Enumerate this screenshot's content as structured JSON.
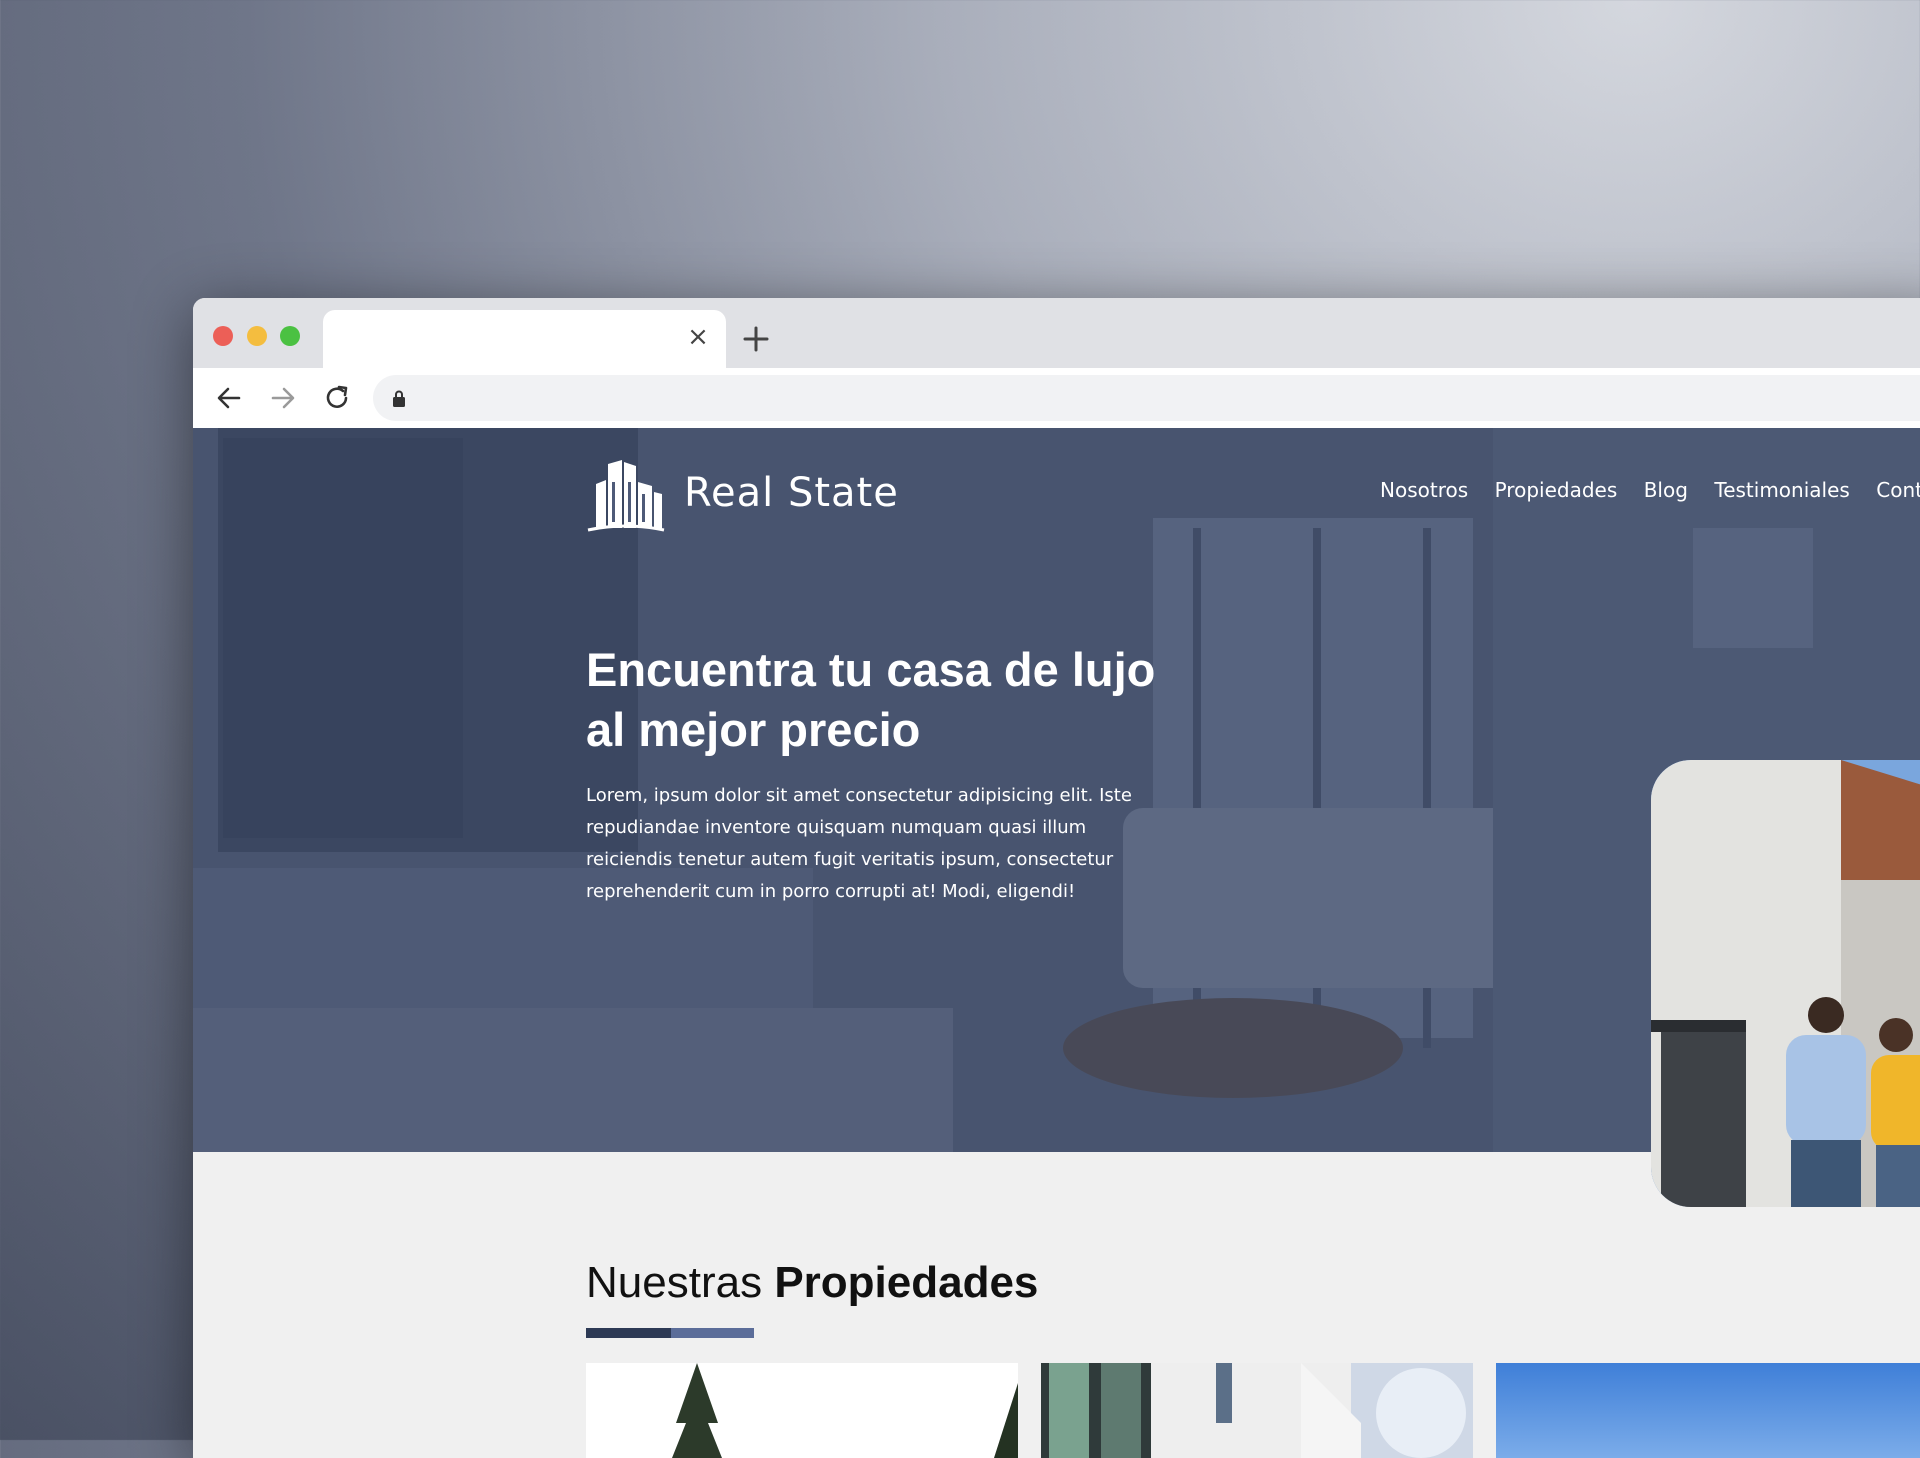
{
  "browser": {
    "tab_close_symbol": "×",
    "icons": {
      "close": "close-icon",
      "new_tab": "plus-icon",
      "back": "arrow-left-icon",
      "forward": "arrow-right-icon",
      "reload": "reload-icon",
      "secure": "lock-icon"
    },
    "traffic_light_colors": [
      "#ec5f57",
      "#f4bd3f",
      "#4bc142"
    ]
  },
  "site": {
    "brand": "Real State",
    "nav": [
      "Nosotros",
      "Propiedades",
      "Blog",
      "Testimoniales",
      "Contacto"
    ],
    "hero": {
      "title": "Encuentra tu casa de lujo al mejor precio",
      "text": "Lorem, ipsum dolor sit amet consectetur adipisicing elit. Iste repudiandae inventore quisquam numquam quasi illum reiciendis tenetur autem fugit veritatis ipsum, consectetur reprehenderit cum in porro corrupti at! Modi, eligendi!"
    },
    "section": {
      "title_regular": "Nuestras",
      "title_bold": "Propiedades"
    },
    "colors": {
      "hero_overlay": "#46526e",
      "accent_dark": "#2d3a55",
      "accent_light": "#5b6d99",
      "page_background": "#f0f0f0"
    }
  }
}
